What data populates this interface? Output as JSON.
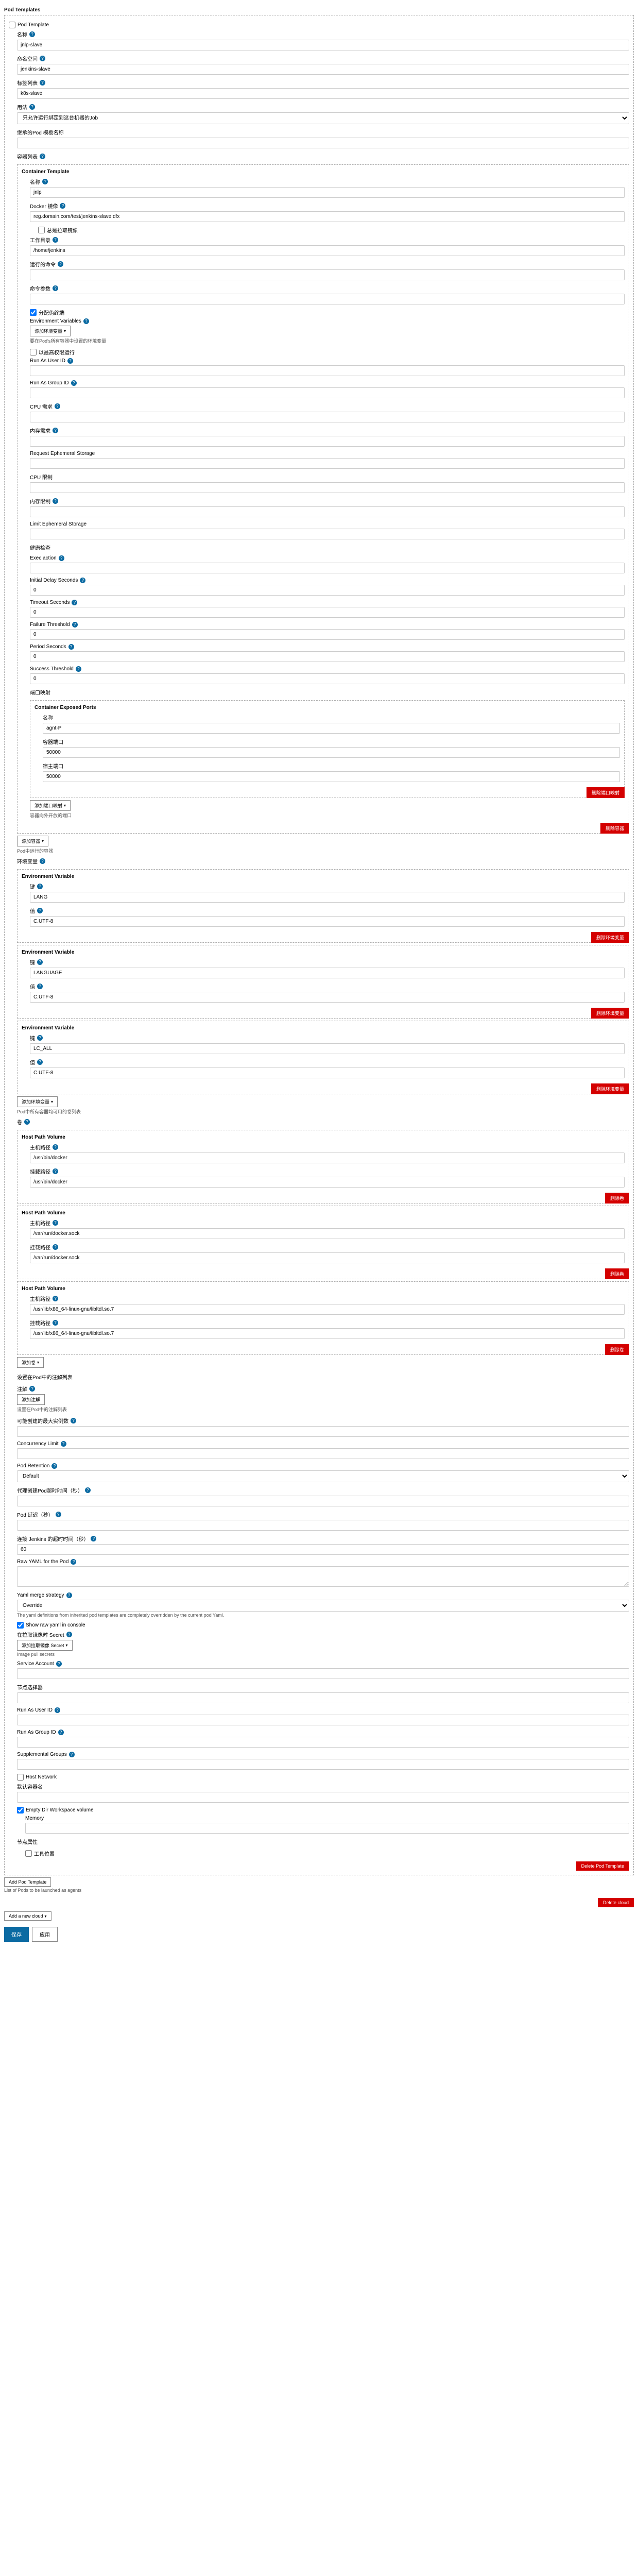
{
  "pod_templates_title": "Pod Templates",
  "pod_template_check": "Pod Template",
  "name_label": "名称",
  "name_help": "?",
  "name_value": "jnlp-slave",
  "namespace_label": "命名空间",
  "namespace_value": "jenkins-slave",
  "labels_label": "标签列表",
  "labels_value": "k8s-slave",
  "usage_label": "用法",
  "usage_option": "只允许运行绑定到这台机器的Job",
  "inherit_label": "继承的Pod 模板名称",
  "inherit_value": "",
  "containers_label": "容器列表",
  "container_template": "Container Template",
  "c_name_label": "名称",
  "c_name_value": "jnlp",
  "c_image_label": "Docker 镜像",
  "c_image_value": "reg.domain.com/test/jenkins-slave:dfx",
  "c_alwayspull": "总是拉取镜像",
  "c_workdir_label": "工作目录",
  "c_workdir_value": "/home/jenkins",
  "c_cmd_label": "运行的命令",
  "c_cmd_value": "",
  "c_args_label": "命令参数",
  "c_args_value": "",
  "c_tty": "分配伪终端",
  "c_tty_checked": true,
  "envvars_label": "Environment Variables",
  "add_envvar_btn": "添加环境变量",
  "envvar_hint": "要在Pod's所有容器中设置的环境变量",
  "c_priv": "以最高权限运行",
  "run_user": "Run As User ID",
  "run_group": "Run As Group ID",
  "cpu_req": "CPU 需求",
  "mem_req": "内存需求",
  "req_eph": "Request Ephemeral Storage",
  "cpu_limit": "CPU 限制",
  "mem_limit": "内存限制",
  "limit_eph": "Limit Ephemeral Storage",
  "liveness": "健康检查",
  "exec_action": "Exec action",
  "init_delay": "Initial Delay Seconds",
  "init_delay_v": "0",
  "timeout_sec": "Timeout Seconds",
  "timeout_sec_v": "0",
  "failure_thr": "Failure Threshold",
  "failure_thr_v": "0",
  "period_sec": "Period Seconds",
  "period_sec_v": "0",
  "success_thr": "Success Threshold",
  "success_thr_v": "0",
  "ports_label": "端口映射",
  "exposed_ports": "Container Exposed Ports",
  "port_name": "名称",
  "port_name_v": "agnt-P",
  "port_cport": "容器端口",
  "port_cport_v": "50000",
  "port_hport": "宿主端口",
  "port_hport_v": "50000",
  "delete_port_btn": "删除端口映射",
  "add_port_btn": "添加端口映射",
  "port_hint": "容器向外开放的端口",
  "delete_container_btn": "删除容器",
  "add_container_btn": "添加容器",
  "container_hint": "Pod中运行的容器",
  "global_env_label": "环境变量",
  "env1_title": "Environment Variable",
  "env1_key": "键",
  "env1_key_v": "LANG",
  "env1_val": "值",
  "env1_val_v": "C.UTF-8",
  "delete_envvar": "删除环境变量",
  "env2_key_v": "LANGUAGE",
  "env2_val_v": "C.UTF-8",
  "env3_key_v": "LC_ALL",
  "env3_val_v": "C.UTF-8",
  "volumes_label": "卷",
  "volume_hint": "Pod中所有容器均可用的卷列表",
  "hpv_title": "Host Path Volume",
  "hpv_host": "主机路径",
  "hpv_mount": "挂载路径",
  "v1_host": "/usr/bin/docker",
  "v1_mount": "/usr/bin/docker",
  "v2_host": "/var/run/docker.sock",
  "v2_mount": "/var/run/docker.sock",
  "v3_host": "/usr/lib/x86_64-linux-gnu/libltdl.so.7",
  "v3_mount": "/usr/lib/x86_64-linux-gnu/libltdl.so.7",
  "delete_vol": "删除卷",
  "add_vol": "添加卷",
  "annotations_label": "注解",
  "annotation_hint": "设置在Pod中的注解列表",
  "add_annotation": "添加注解",
  "max_instances": "可能创建的最大实例数",
  "concurrency": "Concurrency Limit",
  "pod_retention": "Pod Retention",
  "pod_retention_v": "Default",
  "timeout_label": "代理创建Pod超时时间（秒）",
  "pod_delay": "Pod 延迟（秒）",
  "connect_timeout": "连接 Jenkins 的超时时间（秒）",
  "connect_timeout_v": "60",
  "raw_yaml": "Raw YAML for the Pod",
  "yaml_merge": "Yaml merge strategy",
  "yaml_merge_v": "Override",
  "yaml_merge_hint": "The yaml definitions from inherited pod templates are completely overridden by the current pod Yaml.",
  "show_raw": "Show raw yaml in console",
  "show_raw_checked": true,
  "image_pull_secret": "在拉取镜像时 Secret",
  "add_image_pull": "添加拉取镜像 Secret",
  "image_pull_hint": "Image pull secrets",
  "service_account": "Service Account",
  "node_sel": "节点选择器",
  "run_as_uid": "Run As User ID",
  "run_as_gid": "Run As Group ID",
  "supplemental": "Supplemental Groups",
  "host_network": "Host Network",
  "default_container": "默认容器名",
  "empty_wv": "Empty Dir Workspace volume",
  "memory_label": "Memory",
  "disk_label": "节点属性",
  "disk_check": "工具位置",
  "delete_pod_template": "Delete Pod Template",
  "add_pod_template": "Add Pod Template",
  "new_cloud_hint": "List of Pods to be launched as agents",
  "delete_cloud": "Delete cloud",
  "add_new_cloud": "Add a new cloud",
  "save": "保存",
  "apply": "应用"
}
